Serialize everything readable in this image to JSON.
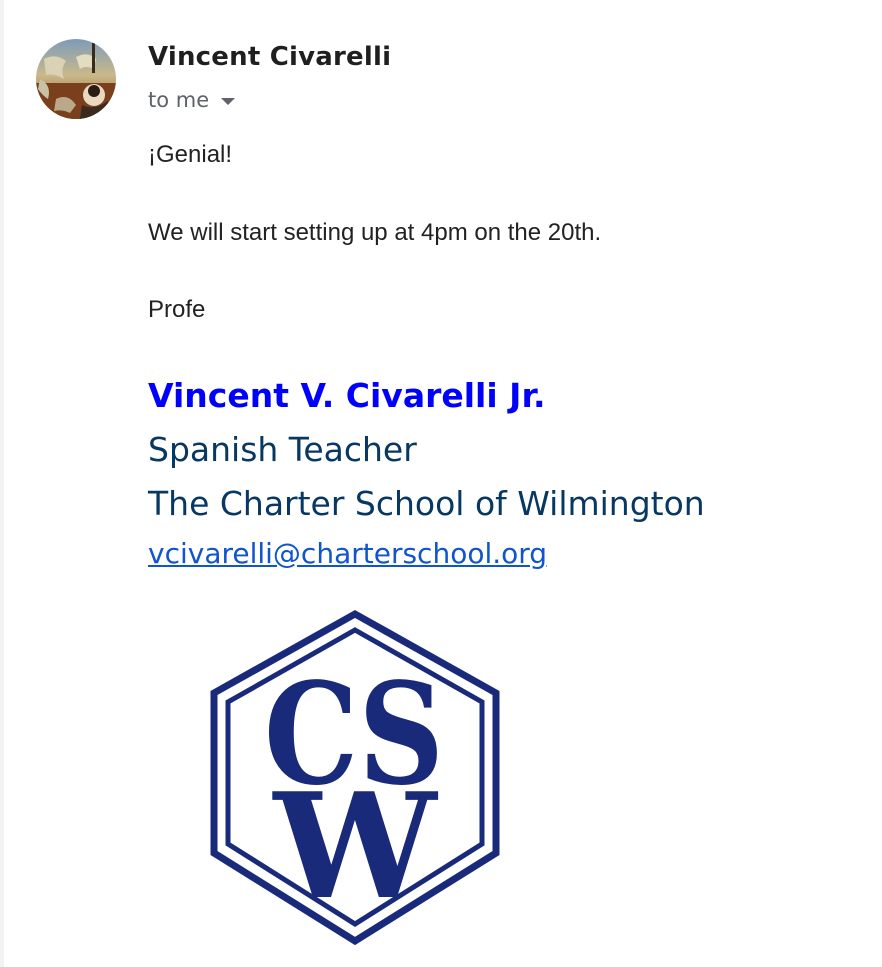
{
  "sender": {
    "name": "Vincent Civarelli",
    "recipient_label": "to me"
  },
  "message": {
    "lines": [
      "¡Genial!",
      "We will start setting up at 4pm on the 20th.",
      "Profe"
    ]
  },
  "signature": {
    "name": "Vincent V. Civarelli Jr.",
    "title": "Spanish Teacher",
    "school": "The Charter School of Wilmington",
    "email": "vcivarelli@charterschool.org",
    "logo_letters": "CSW"
  },
  "colors": {
    "signature_name": "#0000ff",
    "signature_text": "#073763",
    "link": "#1155cc",
    "logo": "#1a2a7a"
  },
  "icons": {
    "avatar": "sender-avatar-painting",
    "recipient_caret": "chevron-down-icon"
  }
}
